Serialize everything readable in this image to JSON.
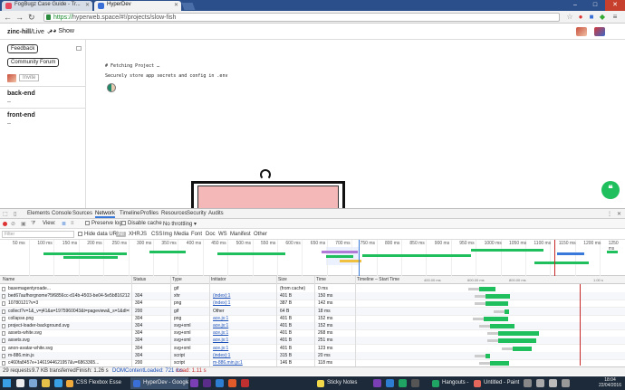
{
  "browser": {
    "tabs": [
      {
        "label": "FogBugz Case Guide - Tr..."
      },
      {
        "label": "HyperDev"
      }
    ],
    "url_scheme": "https://",
    "url_rest": "hyperweb.space/#!/projects/slow-fish",
    "window_controls": {
      "minimize": "–",
      "maximize": "□",
      "close": "✕"
    }
  },
  "app": {
    "project": "zinc-hill",
    "live": "/Live",
    "live_chevron": "⌄",
    "show": "Show"
  },
  "sidebar": {
    "feedback": "Feedback",
    "community": "Community Forum",
    "invite": "Invite",
    "sections": [
      {
        "title": "back-end",
        "dash": "–"
      },
      {
        "title": "front-end",
        "dash": "–"
      }
    ]
  },
  "editor": {
    "heading": "# Fetching Project …",
    "subtitle": "Securely store app secrets and config in .env"
  },
  "devtools": {
    "tabs": [
      "Elements",
      "Console",
      "Sources",
      "Network",
      "Timeline",
      "Profiles",
      "Resources",
      "Security",
      "Audits"
    ],
    "active_tab": "Network",
    "toolbar": {
      "view": "View:",
      "preserve_log": "Preserve log",
      "disable_cache": "Disable cache",
      "throttle": "No throttling"
    },
    "filter": {
      "placeholder": "Filter",
      "hide_data": "Hide data URLs",
      "types": [
        "All",
        "XHR",
        "JS",
        "CSS",
        "Img",
        "Media",
        "Font",
        "Doc",
        "WS",
        "Manifest",
        "Other"
      ]
    },
    "overview_ticks": [
      "50 ms",
      "100 ms",
      "150 ms",
      "200 ms",
      "250 ms",
      "300 ms",
      "350 ms",
      "400 ms",
      "450 ms",
      "500 ms",
      "550 ms",
      "600 ms",
      "650 ms",
      "700 ms",
      "750 ms",
      "800 ms",
      "850 ms",
      "900 ms",
      "950 ms",
      "1000 ms",
      "1050 ms",
      "1100 ms",
      "1150 ms",
      "1200 ms",
      "1250 ms"
    ],
    "columns": [
      "Name",
      "Status",
      "Type",
      "Initiator",
      "Size",
      "Time",
      "Timeline – Start Time"
    ],
    "timeline_ticks": [
      "400.00 ms",
      "600.00 ms",
      "800.00 ms",
      "1.00 s"
    ],
    "rows": [
      {
        "name": "basemagentyroade...",
        "status": "",
        "type": "gif",
        "initiator": "",
        "size": "(from cache)",
        "time": "0 ms",
        "wf_start": 0.76,
        "wf_len": 0.12
      },
      {
        "name": "bed67aufhorgnome?5f6856cc-d14b-4503-be04-5e5b81621216",
        "status": "304",
        "type": "xhr",
        "initiator": "(index):1",
        "size": "401 B",
        "time": "150 ms",
        "wf_start": 0.8,
        "wf_len": 0.18
      },
      {
        "name": "10780121?v=3",
        "status": "304",
        "type": "png",
        "initiator": "(index):1",
        "size": "387 B",
        "time": "142 ms",
        "wf_start": 0.8,
        "wf_len": 0.17
      },
      {
        "name": "collect?v=1&_v=j41&a=1975960043&t=pageview&_s=1&dl=https...",
        "status": "200",
        "type": "gif",
        "initiator": "Other",
        "size": "64 B",
        "time": "18 ms",
        "wf_start": 0.92,
        "wf_len": 0.03
      },
      {
        "name": "collapse.png",
        "status": "304",
        "type": "png",
        "initiator": "ace.js:1",
        "size": "401 B",
        "time": "152 ms",
        "wf_start": 0.79,
        "wf_len": 0.18
      },
      {
        "name": "project-loader-background.svg",
        "status": "304",
        "type": "svg+xml",
        "initiator": "ace.js:1",
        "size": "401 B",
        "time": "152 ms",
        "wf_start": 0.83,
        "wf_len": 0.18
      },
      {
        "name": "assets-white.svg",
        "status": "304",
        "type": "svg+xml",
        "initiator": "ace.js:1",
        "size": "401 B",
        "time": "268 ms",
        "wf_start": 0.88,
        "wf_len": 0.3
      },
      {
        "name": "assets.svg",
        "status": "304",
        "type": "svg+xml",
        "initiator": "ace.js:1",
        "size": "401 B",
        "time": "251 ms",
        "wf_start": 0.88,
        "wf_len": 0.28
      },
      {
        "name": "anon-avatar-white.svg",
        "status": "304",
        "type": "svg+xml",
        "initiator": "ace.js:1",
        "size": "401 B",
        "time": "123 ms",
        "wf_start": 0.97,
        "wf_len": 0.14
      },
      {
        "name": "m-886.min.js",
        "status": "304",
        "type": "script",
        "initiator": "(index):1",
        "size": "315 B",
        "time": "20 ms",
        "wf_start": 0.8,
        "wf_len": 0.03
      },
      {
        "name": "c460fa8457e+1461944621957&v=6863365...",
        "status": "200",
        "type": "script",
        "initiator": "m-886.min.js:1",
        "size": "146 B",
        "time": "118 ms",
        "wf_start": 0.83,
        "wf_len": 0.14
      }
    ],
    "status": {
      "requests": "29 requests",
      "transferred": "9.7 KB transferred",
      "finish": "Finish: 1.26 s",
      "dcl": "DOMContentLoaded: 721 ms",
      "load": "Load: 1.11 s"
    }
  },
  "taskbar": {
    "items": [
      {
        "label": "CSS Flexbox Essenti...",
        "color": "#f0a93b"
      },
      {
        "label": "HyperDev - Google ...",
        "color": "#3a6fd8",
        "active": true
      },
      {
        "label": "Sticky Notes",
        "color": "#f3d94a"
      },
      {
        "label": "Hangouts - danny...",
        "color": "#1fa463"
      },
      {
        "label": "Untitled - Paint",
        "color": "#e3675a"
      }
    ],
    "time": "18:04",
    "date": "22/04/2016"
  },
  "colors": {
    "accent": "#3879d9",
    "waterfall": "#1fbf5e",
    "pink_canvas": "#f4b8b8"
  }
}
